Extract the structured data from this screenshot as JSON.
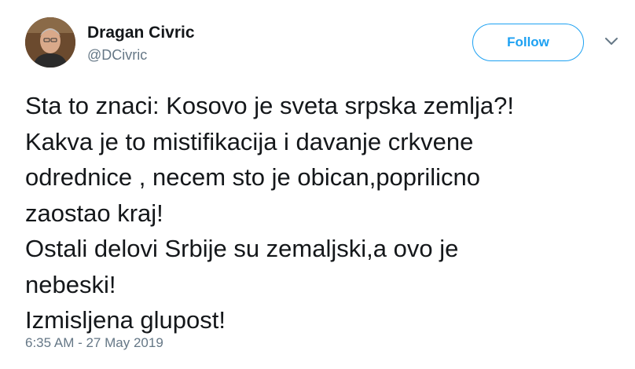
{
  "author": {
    "name": "Dragan Civric",
    "handle": "@DCivric",
    "avatar_icon": "profile-photo"
  },
  "actions": {
    "follow_label": "Follow",
    "menu_icon": "chevron-down-icon"
  },
  "tweet": {
    "lines": [
      "Sta to znaci: Kosovo je sveta srpska zemlja?!",
      "Kakva je to mistifikacija i davanje crkvene",
      "odrednice , necem sto je obican,poprilicno",
      "zaostao kraj!",
      "Ostali delovi Srbije su zemaljski,a ovo je",
      "nebeski!",
      "Izmisljena glupost!"
    ],
    "timestamp": "6:35 AM - 27 May 2019"
  },
  "colors": {
    "accent": "#1da1f2",
    "text_primary": "#14171a",
    "text_secondary": "#657786"
  }
}
